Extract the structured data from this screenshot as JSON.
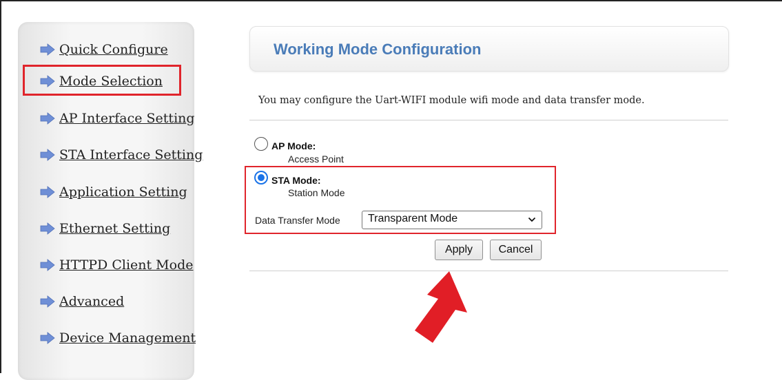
{
  "sidebar": {
    "items": [
      {
        "label": "Quick Configure",
        "icon": "arrow-right-icon"
      },
      {
        "label": "Mode Selection",
        "icon": "arrow-right-icon"
      },
      {
        "label": "AP Interface Setting",
        "icon": "arrow-right-icon"
      },
      {
        "label": "STA Interface Setting",
        "icon": "arrow-right-icon"
      },
      {
        "label": "Application Setting",
        "icon": "arrow-right-icon"
      },
      {
        "label": "Ethernet Setting",
        "icon": "arrow-right-icon"
      },
      {
        "label": "HTTPD Client Mode",
        "icon": "arrow-right-icon"
      },
      {
        "label": "Advanced",
        "icon": "arrow-right-icon"
      },
      {
        "label": "Device Management",
        "icon": "arrow-right-icon"
      }
    ],
    "selected_index": 1
  },
  "main": {
    "title": "Working Mode Configuration",
    "description": "You may configure the Uart-WIFI module wifi mode and data transfer mode.",
    "modes": [
      {
        "label": "AP Mode:",
        "sub": "Access Point",
        "checked": false
      },
      {
        "label": "STA Mode:",
        "sub": "Station Mode",
        "checked": true
      }
    ],
    "data_transfer": {
      "label": "Data Transfer Mode",
      "value": "Transparent Mode"
    },
    "buttons": {
      "apply": "Apply",
      "cancel": "Cancel"
    }
  },
  "colors": {
    "highlight": "#e0242b",
    "title": "#4a7cb8",
    "radio_checked": "#1a73e8",
    "nav_arrow": "#6f8fd6"
  }
}
